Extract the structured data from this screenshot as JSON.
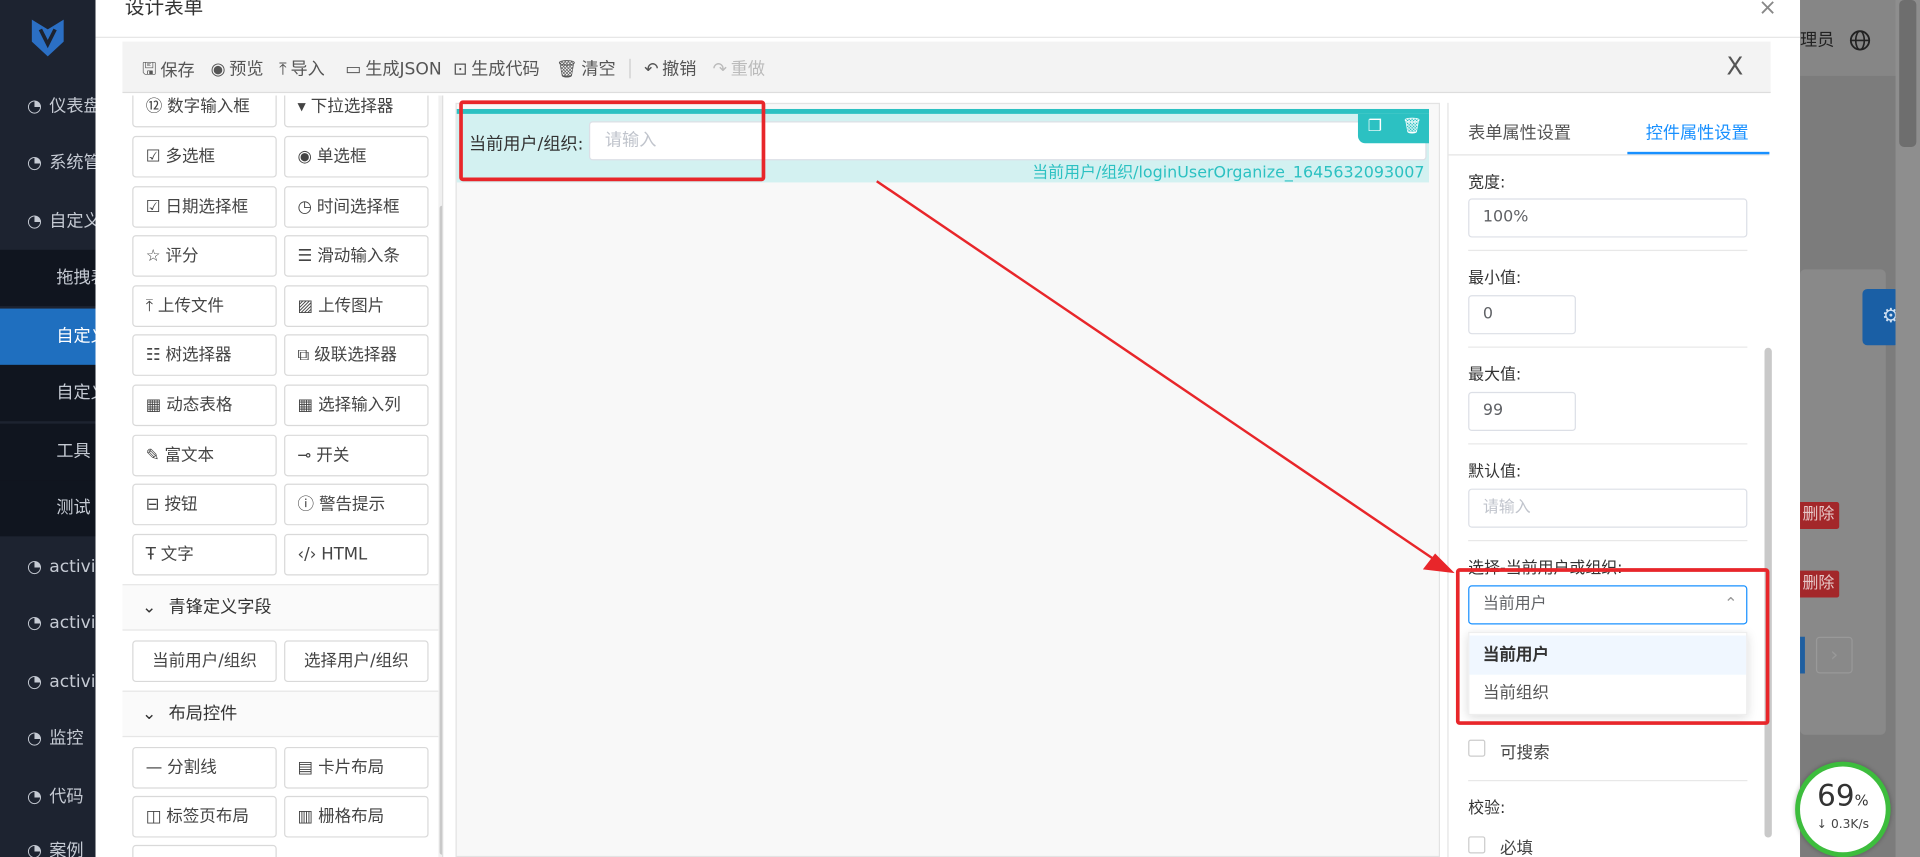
{
  "sidebar": {
    "items": [
      {
        "icon": "dashboard-icon",
        "label": "仪表盘"
      },
      {
        "icon": "dashboard-icon",
        "label": "系统管理"
      },
      {
        "icon": "dashboard-icon",
        "label": "自定义"
      },
      {
        "icon": "",
        "label": "拖拽表单"
      },
      {
        "icon": "",
        "label": "自定义表单"
      },
      {
        "icon": "",
        "label": "自定义"
      },
      {
        "icon": "",
        "label": "工具"
      },
      {
        "icon": "",
        "label": "测试"
      },
      {
        "icon": "dashboard-icon",
        "label": "activiti"
      },
      {
        "icon": "dashboard-icon",
        "label": "activiti"
      },
      {
        "icon": "dashboard-icon",
        "label": "activiti"
      },
      {
        "icon": "dashboard-icon",
        "label": "监控"
      },
      {
        "icon": "dashboard-icon",
        "label": "代码"
      },
      {
        "icon": "dashboard-icon",
        "label": "案例"
      }
    ]
  },
  "background": {
    "user_label": "理员",
    "delete_label": "删除"
  },
  "dialog": {
    "title": "设计表单",
    "close": "×"
  },
  "toolbar": {
    "save": "保存",
    "preview": "预览",
    "import": "导入",
    "gen_json": "生成JSON",
    "gen_code": "生成代码",
    "clear": "清空",
    "undo": "撤销",
    "redo": "重做",
    "close": "X"
  },
  "components": {
    "basic": [
      {
        "icon": "number-input-icon",
        "label": "数字输入框"
      },
      {
        "icon": "dropdown-icon",
        "label": "下拉选择器"
      },
      {
        "icon": "checkbox-icon",
        "label": "多选框"
      },
      {
        "icon": "radio-icon",
        "label": "单选框"
      },
      {
        "icon": "calendar-icon",
        "label": "日期选择框"
      },
      {
        "icon": "clock-icon",
        "label": "时间选择框"
      },
      {
        "icon": "star-icon",
        "label": "评分"
      },
      {
        "icon": "slider-icon",
        "label": "滑动输入条"
      },
      {
        "icon": "upload-icon",
        "label": "上传文件"
      },
      {
        "icon": "image-icon",
        "label": "上传图片"
      },
      {
        "icon": "tree-icon",
        "label": "树选择器"
      },
      {
        "icon": "cascader-icon",
        "label": "级联选择器"
      },
      {
        "icon": "table-icon",
        "label": "动态表格"
      },
      {
        "icon": "table-icon",
        "label": "选择输入列"
      },
      {
        "icon": "richtext-icon",
        "label": "富文本"
      },
      {
        "icon": "switch-icon",
        "label": "开关"
      },
      {
        "icon": "button-icon",
        "label": "按钮"
      },
      {
        "icon": "alert-icon",
        "label": "警告提示"
      },
      {
        "icon": "text-icon",
        "label": "文字"
      },
      {
        "icon": "html-icon",
        "label": "HTML"
      }
    ],
    "custom_section": "青锋定义字段",
    "custom": [
      {
        "label": "当前用户/组织"
      },
      {
        "label": "选择用户/组织"
      }
    ],
    "layout_section": "布局控件",
    "layout": [
      {
        "icon": "divider-icon",
        "label": "分割线"
      },
      {
        "icon": "card-icon",
        "label": "卡片布局"
      },
      {
        "icon": "tabs-icon",
        "label": "标签页布局"
      },
      {
        "icon": "grid-icon",
        "label": "栅格布局"
      }
    ]
  },
  "canvas": {
    "field_label": "当前用户/组织:",
    "field_placeholder": "请输入",
    "field_model": "当前用户/组织/loginUserOrganize_1645632093007"
  },
  "props": {
    "tab_form": "表单属性设置",
    "tab_control": "控件属性设置",
    "width_label": "宽度:",
    "width_value": "100%",
    "min_label": "最小值:",
    "min_value": "0",
    "max_label": "最大值:",
    "max_value": "99",
    "default_label": "默认值:",
    "default_placeholder": "请输入",
    "select_label": "选择-当前用户或组织:",
    "select_value": "当前用户",
    "options": [
      "当前用户",
      "当前组织"
    ],
    "searchable_label": "可搜索",
    "validate_label": "校验:",
    "required_label": "必填"
  },
  "net_widget": {
    "percent": "69",
    "percent_unit": "%",
    "rate": "0.3K/s"
  },
  "colors": {
    "accent": "#1890ff",
    "teal": "#2cc1c2",
    "annotation": "#e8262a",
    "sidebar_bg": "#1d2330"
  }
}
